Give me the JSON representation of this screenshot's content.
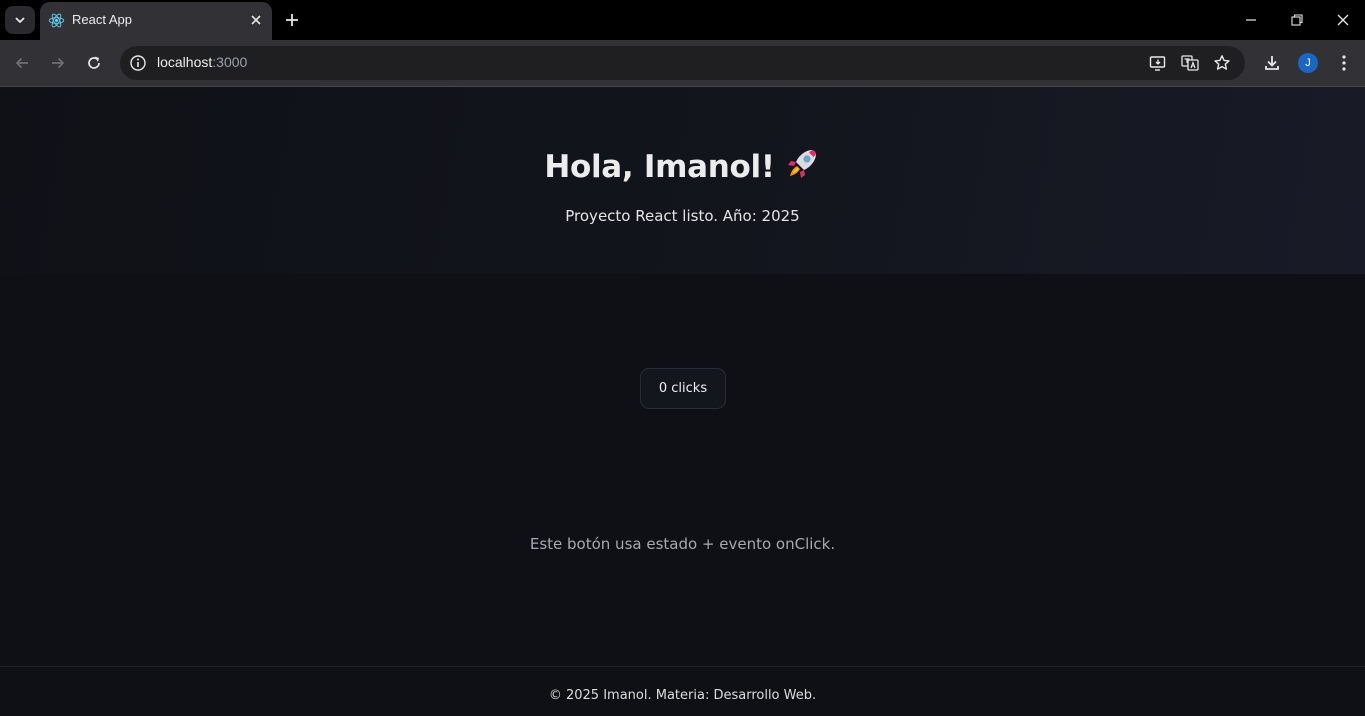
{
  "browser": {
    "tab": {
      "title": "React App",
      "favicon": "react-logo-icon"
    },
    "url": {
      "host": "localhost",
      "port": ":3000"
    },
    "profile_initial": "J",
    "colors": {
      "tabstrip": "#000000",
      "toolbar": "#323236",
      "avatar": "#1a66c2"
    }
  },
  "page": {
    "title": "Hola, Imanol!",
    "title_emoji": "rocket-icon",
    "subtitle": "Proyecto React listo. Año: 2025",
    "counter_label": "0 clicks",
    "hint": "Este botón usa estado + evento onClick.",
    "footer": "© 2025 Imanol. Materia: Desarrollo Web."
  }
}
